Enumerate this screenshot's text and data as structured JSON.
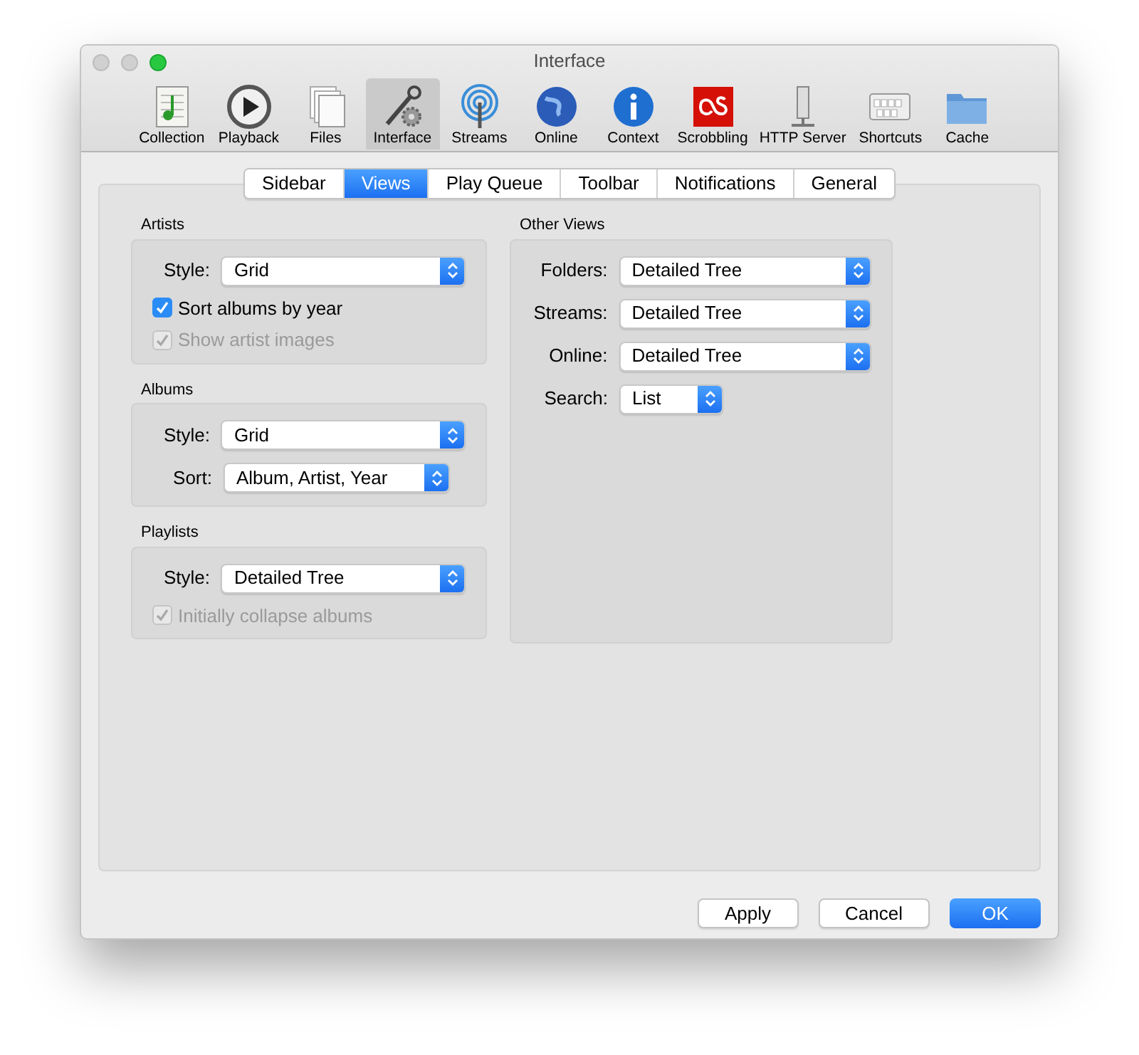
{
  "window": {
    "title": "Interface"
  },
  "toolbar": [
    {
      "label": "Collection",
      "selected": false
    },
    {
      "label": "Playback",
      "selected": false
    },
    {
      "label": "Files",
      "selected": false
    },
    {
      "label": "Interface",
      "selected": true
    },
    {
      "label": "Streams",
      "selected": false
    },
    {
      "label": "Online",
      "selected": false
    },
    {
      "label": "Context",
      "selected": false
    },
    {
      "label": "Scrobbling",
      "selected": false
    },
    {
      "label": "HTTP Server",
      "selected": false
    },
    {
      "label": "Shortcuts",
      "selected": false
    },
    {
      "label": "Cache",
      "selected": false
    }
  ],
  "tabs": [
    {
      "label": "Sidebar",
      "selected": false
    },
    {
      "label": "Views",
      "selected": true
    },
    {
      "label": "Play Queue",
      "selected": false
    },
    {
      "label": "Toolbar",
      "selected": false
    },
    {
      "label": "Notifications",
      "selected": false
    },
    {
      "label": "General",
      "selected": false
    }
  ],
  "left_groups": [
    {
      "title": "Artists",
      "rows": [
        {
          "kind": "select",
          "label": "Style:",
          "value": "Grid"
        },
        {
          "kind": "checkbox",
          "label": "Sort albums by year",
          "checked": true,
          "disabled": false
        },
        {
          "kind": "checkbox",
          "label": "Show artist images",
          "checked": true,
          "disabled": true
        }
      ]
    },
    {
      "title": "Albums",
      "rows": [
        {
          "kind": "select",
          "label": "Style:",
          "value": "Grid"
        },
        {
          "kind": "select",
          "label": "Sort:",
          "value": "Album, Artist, Year"
        }
      ]
    },
    {
      "title": "Playlists",
      "rows": [
        {
          "kind": "select",
          "label": "Style:",
          "value": "Detailed Tree"
        },
        {
          "kind": "checkbox",
          "label": "Initially collapse albums",
          "checked": true,
          "disabled": true
        }
      ]
    }
  ],
  "right_groups": [
    {
      "title": "Other Views",
      "rows": [
        {
          "kind": "select",
          "label": "Folders:",
          "value": "Detailed Tree"
        },
        {
          "kind": "select",
          "label": "Streams:",
          "value": "Detailed Tree"
        },
        {
          "kind": "select",
          "label": "Online:",
          "value": "Detailed Tree"
        },
        {
          "kind": "select",
          "label": "Search:",
          "value": "List"
        }
      ]
    }
  ],
  "buttons": [
    {
      "label": "Apply",
      "default": false
    },
    {
      "label": "Cancel",
      "default": false
    },
    {
      "label": "OK",
      "default": true
    }
  ]
}
